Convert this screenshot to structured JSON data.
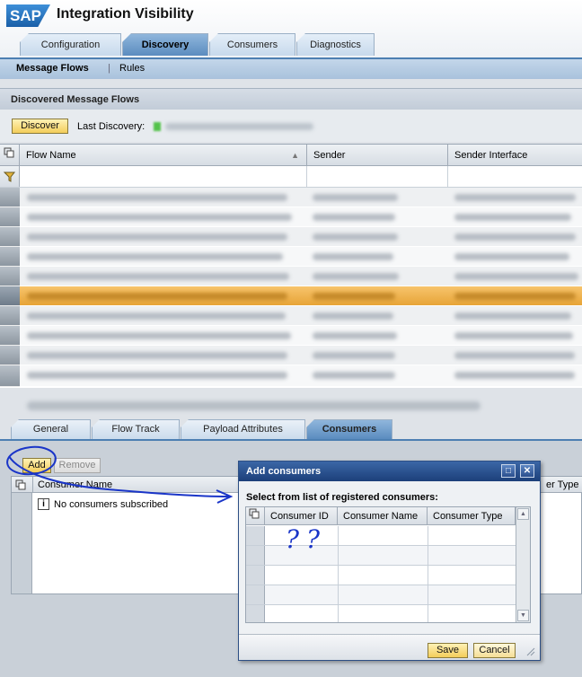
{
  "app": {
    "logo": "SAP",
    "title": "Integration Visibility"
  },
  "top_tabs": [
    {
      "label": "Configuration"
    },
    {
      "label": "Discovery"
    },
    {
      "label": "Consumers"
    },
    {
      "label": "Diagnostics"
    }
  ],
  "sub_nav": {
    "message_flows": "Message Flows",
    "rules": "Rules"
  },
  "section": {
    "title": "Discovered Message Flows",
    "discover_button": "Discover",
    "last_discovery_label": "Last Discovery:"
  },
  "flows_table": {
    "columns": [
      "Flow Name",
      "Sender",
      "Sender Interface"
    ]
  },
  "detail_tabs": [
    {
      "label": "General"
    },
    {
      "label": "Flow Track"
    },
    {
      "label": "Payload Attributes"
    },
    {
      "label": "Consumers"
    }
  ],
  "consumers_panel": {
    "add_button": "Add",
    "remove_button": "Remove",
    "column": "Consumer Name",
    "empty_message": "No consumers subscribed",
    "partial_column": "er Type"
  },
  "dialog": {
    "title": "Add consumers",
    "subtitle": "Select from list of registered consumers:",
    "columns": [
      "Consumer ID",
      "Consumer Name",
      "Consumer Type"
    ],
    "save_button": "Save",
    "cancel_button": "Cancel"
  },
  "annotation": {
    "handwritten_text": "??"
  },
  "colors": {
    "accent": "#4d7fb2",
    "highlight_row": "#e7a437",
    "annotation": "#1a35c8"
  }
}
